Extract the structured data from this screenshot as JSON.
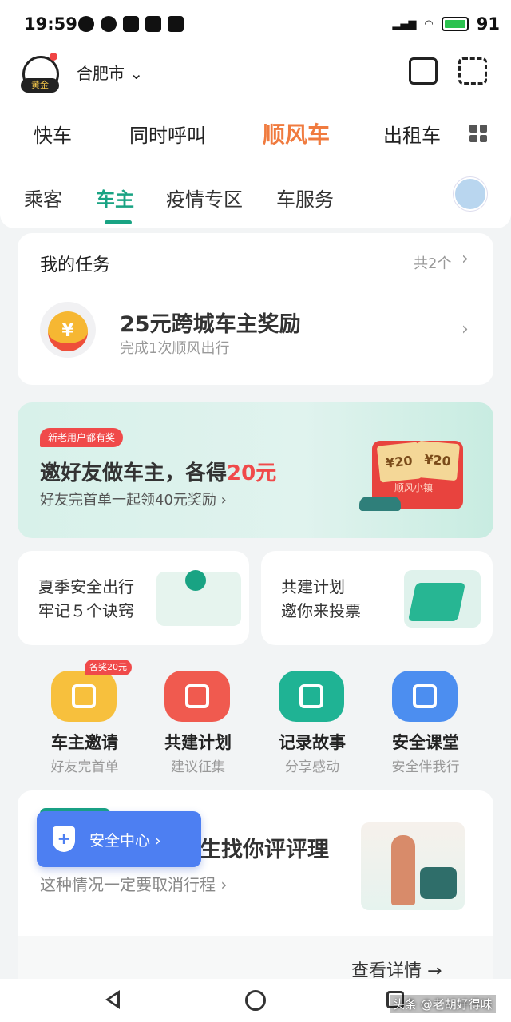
{
  "status_bar": {
    "time": "19:59",
    "battery": "91"
  },
  "header": {
    "badge": "黄金",
    "city": "合肥市",
    "city_chevron": "⌄",
    "modes": [
      "快车",
      "同时呼叫",
      "顺风车",
      "出租车"
    ]
  },
  "tabs": [
    "乘客",
    "车主",
    "疫情专区",
    "车服务"
  ],
  "task": {
    "title": "我的任务",
    "count": "共2个",
    "coin_symbol": "¥",
    "name": "25元跨城车主奖励",
    "sub": "完成1次顺风出行"
  },
  "banner": {
    "tag": "新老用户都有奖",
    "title_prefix": "邀好友做车主，各得",
    "title_highlight": "20元",
    "sub": "好友完首单一起领40元奖励 ›",
    "voucher": "¥20",
    "envelope_label": "顺风小镇"
  },
  "cards": [
    {
      "line1": "夏季安全出行",
      "line2": "牢记５个诀窍"
    },
    {
      "line1": "共建计划",
      "line2": "邀你来投票"
    }
  ],
  "icon_grid": {
    "badge": "各奖20元",
    "items": [
      {
        "label": "车主邀请",
        "sub": "好友完首单",
        "icon": "gift-icon"
      },
      {
        "label": "共建计划",
        "sub": "建议征集",
        "icon": "edit-icon"
      },
      {
        "label": "记录故事",
        "sub": "分享感动",
        "icon": "book-heart-icon"
      },
      {
        "label": "安全课堂",
        "sub": "安全伴我行",
        "icon": "notebook-icon"
      }
    ]
  },
  "story": {
    "title": "生找你评评理",
    "sub": "这种情况一定要取消行程 ›",
    "detail": "查看详情 →"
  },
  "safety": {
    "label": "安全中心 ›",
    "icon": "shield-icon"
  },
  "watermark": "头条 @老胡好得味",
  "colors": {
    "accent_green": "#19a383",
    "accent_orange": "#f07b3f",
    "safety_blue": "#4d7ff2",
    "highlight_red": "#f04a4a"
  }
}
